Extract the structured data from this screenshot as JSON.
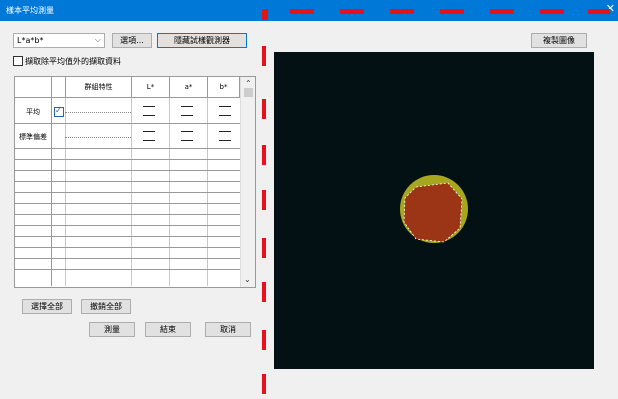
{
  "window": {
    "title": "樣本平均測量",
    "close_glyph": "✕"
  },
  "color_space": {
    "selected": "L*a*b*",
    "arrow": "⌵"
  },
  "toolbar": {
    "options_label": "選項...",
    "hide_tester_label": "隱藏試樣觀測器"
  },
  "exclude_checkbox": {
    "label": "擷取除平均值外的擷取資料",
    "checked": false
  },
  "grid": {
    "headers": {
      "blank": "",
      "check": "",
      "group": "群組特性",
      "L": "L*",
      "a": "a*",
      "b": "b*"
    },
    "rows": [
      {
        "label": "平均",
        "checked": true
      },
      {
        "label": "標準偏差",
        "checked": false
      }
    ],
    "empty_value": "—"
  },
  "footer": {
    "select_all_label": "選擇全部",
    "clear_all_label": "撤銷全部",
    "measure_label": "測量",
    "finish_label": "結束",
    "cancel_label": "取消"
  },
  "preview": {
    "copy_image_label": "複製圖像",
    "background_color": "#041114",
    "outer_ring_color": "#a6a71e",
    "inner_spot_color": "#9c3516"
  },
  "divider_color": "#e8101a"
}
